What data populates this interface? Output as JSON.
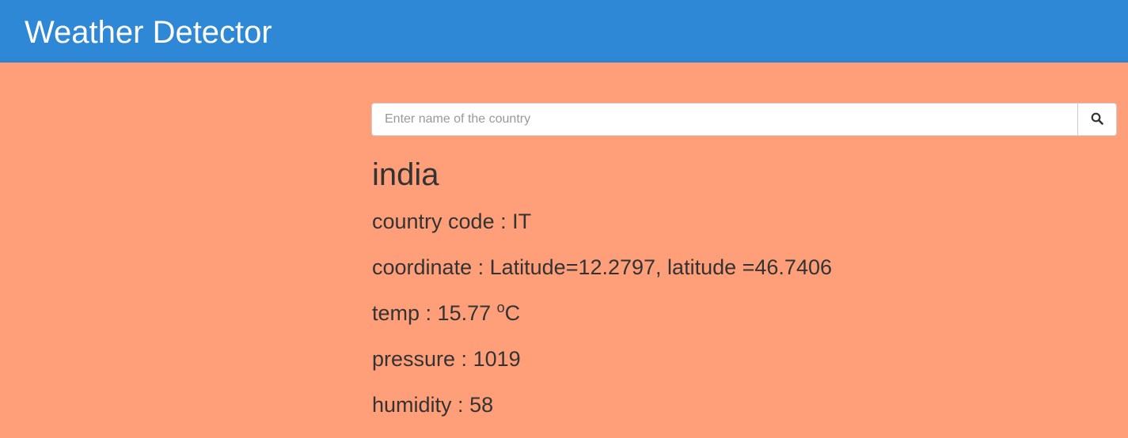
{
  "header": {
    "title": "Weather Detector"
  },
  "search": {
    "placeholder": "Enter name of the country",
    "value": "",
    "button_icon": "search-icon"
  },
  "result": {
    "city": "india",
    "country_code_label": "country code",
    "country_code": "IT",
    "coordinate_label": "coordinate",
    "coordinate_text": "Latitude=12.2797, latitude =46.7406",
    "temp_label": "temp",
    "temp_value": "15.77",
    "temp_degree": "o",
    "temp_unit": "C",
    "pressure_label": "pressure",
    "pressure_value": "1019",
    "humidity_label": "humidity",
    "humidity_value": "58"
  },
  "colors": {
    "navbar": "#2e88d6",
    "background": "#ff9f7a",
    "text": "#333333"
  }
}
